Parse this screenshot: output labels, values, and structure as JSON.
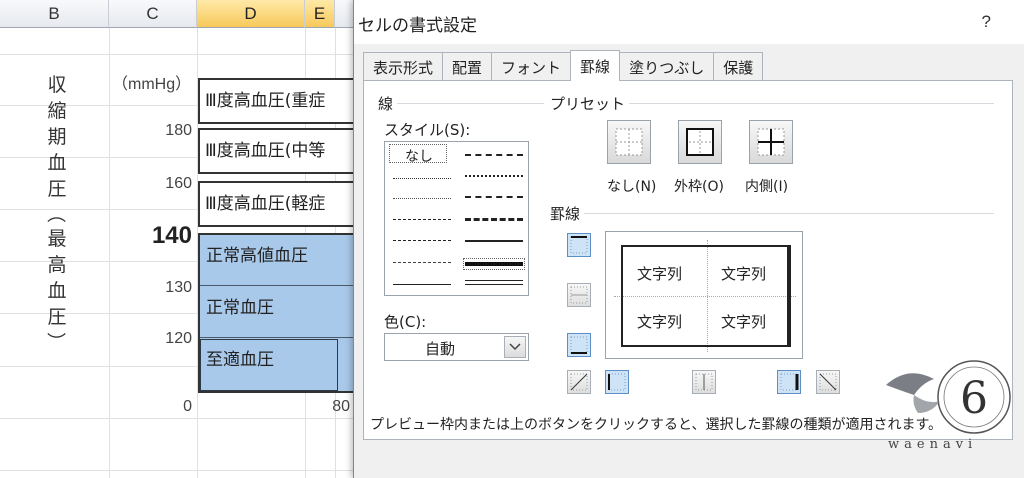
{
  "sheet": {
    "columns": [
      {
        "label": "B",
        "selected": false
      },
      {
        "label": "C",
        "selected": false
      },
      {
        "label": "D",
        "selected": true
      },
      {
        "label": "E",
        "selected": true
      }
    ],
    "vertical_label": [
      "収",
      "縮",
      "期",
      "血",
      "圧",
      "（",
      "最",
      "高",
      "血",
      "圧",
      "）"
    ],
    "unit": "（mmHg）",
    "y_labels": [
      "180",
      "160",
      "140",
      "130",
      "120",
      "0"
    ],
    "x_label": "80",
    "boxes": [
      "Ⅲ度高血圧(重症",
      "Ⅲ度高血圧(中等",
      "Ⅲ度高血圧(軽症"
    ],
    "blue_rows": [
      "正常高値血圧",
      "正常血圧",
      "至適血圧"
    ],
    "colors": {
      "blue_fill": "#a9c9ea",
      "selected_header": "#f7c95a"
    }
  },
  "dialog": {
    "title": "セルの書式設定",
    "help": "?",
    "tabs": [
      {
        "label": "表示形式",
        "active": false
      },
      {
        "label": "配置",
        "active": false
      },
      {
        "label": "フォント",
        "active": false
      },
      {
        "label": "罫線",
        "active": true
      },
      {
        "label": "塗りつぶし",
        "active": false
      },
      {
        "label": "保護",
        "active": false
      }
    ],
    "line_group": "線",
    "style_label": "スタイル(S):",
    "style_none": "なし",
    "color_label": "色(C):",
    "color_value": "自動",
    "preset_group": "プリセット",
    "presets": [
      {
        "label": "なし(N)",
        "icon": "preset-none-icon"
      },
      {
        "label": "外枠(O)",
        "icon": "preset-outline-icon"
      },
      {
        "label": "内側(I)",
        "icon": "preset-inside-icon"
      }
    ],
    "border_group": "罫線",
    "preview_text": [
      "文字列",
      "文字列",
      "文字列",
      "文字列"
    ],
    "help_text": "プレビュー枠内または上のボタンをクリックすると、選択した罫線の種類が適用されます。"
  },
  "watermark": {
    "text": "waenavi",
    "logo_text": "6"
  }
}
